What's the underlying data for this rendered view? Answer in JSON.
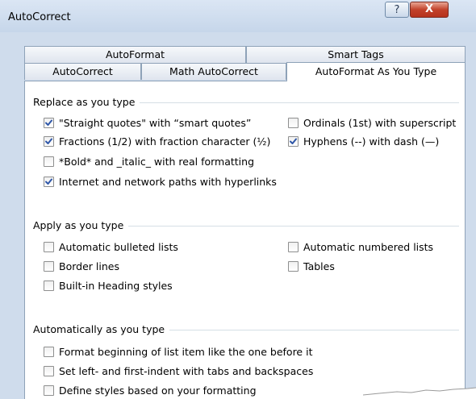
{
  "window": {
    "title": "AutoCorrect",
    "help_label": "?",
    "close_label": "X"
  },
  "tabs": {
    "row1": [
      {
        "label": "AutoFormat"
      },
      {
        "label": "Smart Tags"
      }
    ],
    "row2": [
      {
        "label": "AutoCorrect"
      },
      {
        "label": "Math AutoCorrect"
      },
      {
        "label": "AutoFormat As You Type",
        "active": true
      }
    ]
  },
  "sections": {
    "replace": {
      "label": "Replace as you type",
      "options": [
        {
          "label": "\"Straight quotes\" with “smart quotes”",
          "checked": true
        },
        {
          "label": "Fractions (1/2) with fraction character (½)",
          "checked": true
        },
        {
          "label": "*Bold* and _italic_ with real formatting",
          "checked": false
        },
        {
          "label": "Internet and network paths with hyperlinks",
          "checked": true
        },
        {
          "label": "Ordinals (1st) with superscript",
          "checked": false
        },
        {
          "label": "Hyphens (--) with dash (—)",
          "checked": true
        }
      ]
    },
    "apply": {
      "label": "Apply as you type",
      "options": [
        {
          "label": "Automatic bulleted lists",
          "checked": false
        },
        {
          "label": "Border lines",
          "checked": false
        },
        {
          "label": "Built-in Heading styles",
          "checked": false
        },
        {
          "label": "Automatic numbered lists",
          "checked": false
        },
        {
          "label": "Tables",
          "checked": false
        }
      ]
    },
    "auto": {
      "label": "Automatically as you type",
      "options": [
        {
          "label": "Format beginning of list item like the one before it",
          "checked": false
        },
        {
          "label": "Set left- and first-indent with tabs and backspaces",
          "checked": false
        },
        {
          "label": "Define styles based on your formatting",
          "checked": false
        }
      ]
    }
  },
  "colors": {
    "check": "#2f57a8",
    "dialog_bg": "#cfdcec",
    "close": "#c2412b"
  }
}
